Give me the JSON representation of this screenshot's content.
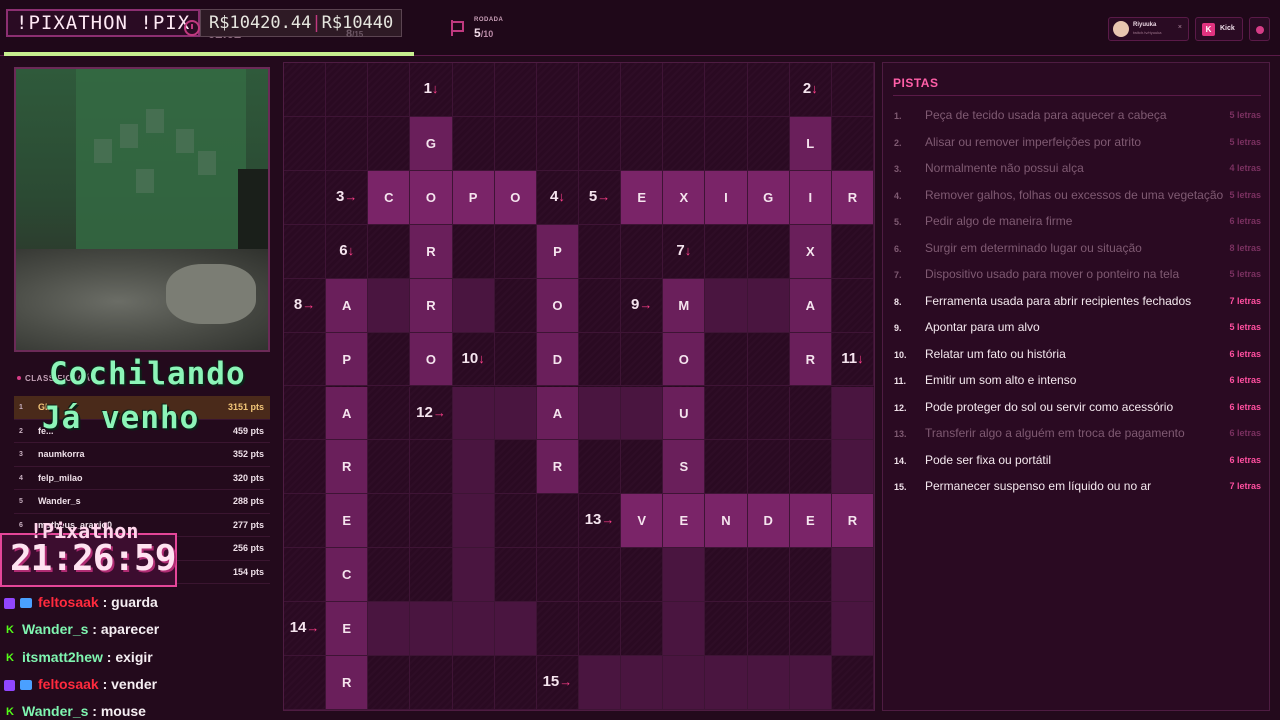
{
  "header": {
    "brand": "!PIXATHON !PIX",
    "timer": "02:02",
    "prize": "R$10420.44",
    "prize_sep": "|",
    "prize_goal": "R$10440",
    "progress": "8",
    "progress_total": "/15",
    "round_label": "RODADA",
    "round_value": "5",
    "round_total": "/10",
    "user_name": "Riyuuka",
    "user_sub": "twitch.tv/riyuuka",
    "user_close": "×",
    "kick_logo": "K",
    "kick_label": "Kick",
    "accent_color": "#d63c86",
    "progress_bar_fraction": 0.32
  },
  "overlay": {
    "status_line1": "Cochilando",
    "status_line2": "Já venho",
    "clock_label": "!Pixathon",
    "clock": "21:26:59"
  },
  "leaderboard": {
    "title": "CLASSIFICAÇÃO",
    "rows": [
      {
        "rank": "1",
        "name": "Gh...",
        "pts": "3151 pts"
      },
      {
        "rank": "2",
        "name": "fe...",
        "pts": "459 pts"
      },
      {
        "rank": "3",
        "name": "naumkorra",
        "pts": "352 pts"
      },
      {
        "rank": "4",
        "name": "felp_milao",
        "pts": "320 pts"
      },
      {
        "rank": "5",
        "name": "Wander_s",
        "pts": "288 pts"
      },
      {
        "rank": "6",
        "name": "matheus_araujo0",
        "pts": "277 pts"
      },
      {
        "rank": "7",
        "name": "",
        "pts": "256 pts"
      },
      {
        "rank": "8",
        "name": "",
        "pts": "154 pts"
      }
    ]
  },
  "chat": [
    {
      "badge": "twitch",
      "extra": true,
      "user": "feltosaak",
      "color": "#ff2a3d",
      "msg": " : guarda"
    },
    {
      "badge": "kick",
      "extra": false,
      "user": "Wander_s",
      "color": "#7ff5b0",
      "msg": " : aparecer"
    },
    {
      "badge": "kick",
      "extra": false,
      "user": "itsmatt2hew",
      "color": "#7ff5b0",
      "msg": " : exigir"
    },
    {
      "badge": "twitch",
      "extra": true,
      "user": "feltosaak",
      "color": "#ff2a3d",
      "msg": " : vender"
    },
    {
      "badge": "kick",
      "extra": false,
      "user": "Wander_s",
      "color": "#7ff5b0",
      "msg": " : mouse"
    }
  ],
  "grid": {
    "rows": 12,
    "cols": 14,
    "cells": [
      {
        "r": 0,
        "c": 3,
        "t": "num",
        "v": "1",
        "a": "↓"
      },
      {
        "r": 0,
        "c": 12,
        "t": "num",
        "v": "2",
        "a": "↓"
      },
      {
        "r": 1,
        "c": 3,
        "t": "letter",
        "v": "G"
      },
      {
        "r": 1,
        "c": 12,
        "t": "letter",
        "v": "L"
      },
      {
        "r": 2,
        "c": 1,
        "t": "num",
        "v": "3",
        "a": "→"
      },
      {
        "r": 2,
        "c": 2,
        "t": "hl",
        "v": "C"
      },
      {
        "r": 2,
        "c": 3,
        "t": "hl",
        "v": "O"
      },
      {
        "r": 2,
        "c": 4,
        "t": "hl",
        "v": "P"
      },
      {
        "r": 2,
        "c": 5,
        "t": "hl",
        "v": "O"
      },
      {
        "r": 2,
        "c": 6,
        "t": "num",
        "v": "4",
        "a": "↓"
      },
      {
        "r": 2,
        "c": 7,
        "t": "num",
        "v": "5",
        "a": "→"
      },
      {
        "r": 2,
        "c": 8,
        "t": "hl",
        "v": "E"
      },
      {
        "r": 2,
        "c": 9,
        "t": "hl",
        "v": "X"
      },
      {
        "r": 2,
        "c": 10,
        "t": "hl",
        "v": "I"
      },
      {
        "r": 2,
        "c": 11,
        "t": "hl",
        "v": "G"
      },
      {
        "r": 2,
        "c": 12,
        "t": "hl",
        "v": "I"
      },
      {
        "r": 2,
        "c": 13,
        "t": "hl",
        "v": "R"
      },
      {
        "r": 3,
        "c": 1,
        "t": "num",
        "v": "6",
        "a": "↓"
      },
      {
        "r": 3,
        "c": 3,
        "t": "letter",
        "v": "R"
      },
      {
        "r": 3,
        "c": 6,
        "t": "letter",
        "v": "P"
      },
      {
        "r": 3,
        "c": 9,
        "t": "num",
        "v": "7",
        "a": "↓"
      },
      {
        "r": 3,
        "c": 12,
        "t": "letter",
        "v": "X"
      },
      {
        "r": 4,
        "c": 0,
        "t": "num",
        "v": "8",
        "a": "→"
      },
      {
        "r": 4,
        "c": 1,
        "t": "letter",
        "v": "A"
      },
      {
        "r": 4,
        "c": 2,
        "t": "active",
        "v": ""
      },
      {
        "r": 4,
        "c": 3,
        "t": "letter",
        "v": "R"
      },
      {
        "r": 4,
        "c": 4,
        "t": "active",
        "v": ""
      },
      {
        "r": 4,
        "c": 6,
        "t": "letter",
        "v": "O"
      },
      {
        "r": 4,
        "c": 8,
        "t": "num",
        "v": "9",
        "a": "→"
      },
      {
        "r": 4,
        "c": 9,
        "t": "letter",
        "v": "M"
      },
      {
        "r": 4,
        "c": 10,
        "t": "active",
        "v": ""
      },
      {
        "r": 4,
        "c": 11,
        "t": "active",
        "v": ""
      },
      {
        "r": 4,
        "c": 12,
        "t": "letter",
        "v": "A"
      },
      {
        "r": 5,
        "c": 1,
        "t": "letter",
        "v": "P"
      },
      {
        "r": 5,
        "c": 3,
        "t": "letter",
        "v": "O"
      },
      {
        "r": 5,
        "c": 4,
        "t": "num",
        "v": "10",
        "a": "↓"
      },
      {
        "r": 5,
        "c": 6,
        "t": "letter",
        "v": "D"
      },
      {
        "r": 5,
        "c": 9,
        "t": "letter",
        "v": "O"
      },
      {
        "r": 5,
        "c": 12,
        "t": "letter",
        "v": "R"
      },
      {
        "r": 5,
        "c": 13,
        "t": "num",
        "v": "11",
        "a": "↓"
      },
      {
        "r": 6,
        "c": 1,
        "t": "letter",
        "v": "A"
      },
      {
        "r": 6,
        "c": 3,
        "t": "num",
        "v": "12",
        "a": "→"
      },
      {
        "r": 6,
        "c": 4,
        "t": "active",
        "v": ""
      },
      {
        "r": 6,
        "c": 5,
        "t": "active",
        "v": ""
      },
      {
        "r": 6,
        "c": 6,
        "t": "letter",
        "v": "A"
      },
      {
        "r": 6,
        "c": 7,
        "t": "active",
        "v": ""
      },
      {
        "r": 6,
        "c": 8,
        "t": "active",
        "v": ""
      },
      {
        "r": 6,
        "c": 9,
        "t": "letter",
        "v": "U"
      },
      {
        "r": 6,
        "c": 13,
        "t": "active",
        "v": ""
      },
      {
        "r": 7,
        "c": 1,
        "t": "letter",
        "v": "R"
      },
      {
        "r": 7,
        "c": 4,
        "t": "active",
        "v": ""
      },
      {
        "r": 7,
        "c": 6,
        "t": "letter",
        "v": "R"
      },
      {
        "r": 7,
        "c": 9,
        "t": "letter",
        "v": "S"
      },
      {
        "r": 7,
        "c": 13,
        "t": "active",
        "v": ""
      },
      {
        "r": 8,
        "c": 1,
        "t": "letter",
        "v": "E"
      },
      {
        "r": 8,
        "c": 4,
        "t": "active",
        "v": ""
      },
      {
        "r": 8,
        "c": 7,
        "t": "num",
        "v": "13",
        "a": "→"
      },
      {
        "r": 8,
        "c": 8,
        "t": "hl",
        "v": "V"
      },
      {
        "r": 8,
        "c": 9,
        "t": "hl",
        "v": "E"
      },
      {
        "r": 8,
        "c": 10,
        "t": "hl",
        "v": "N"
      },
      {
        "r": 8,
        "c": 11,
        "t": "hl",
        "v": "D"
      },
      {
        "r": 8,
        "c": 12,
        "t": "hl",
        "v": "E"
      },
      {
        "r": 8,
        "c": 13,
        "t": "hl",
        "v": "R"
      },
      {
        "r": 9,
        "c": 1,
        "t": "letter",
        "v": "C"
      },
      {
        "r": 9,
        "c": 4,
        "t": "active",
        "v": ""
      },
      {
        "r": 9,
        "c": 9,
        "t": "active",
        "v": ""
      },
      {
        "r": 9,
        "c": 13,
        "t": "active",
        "v": ""
      },
      {
        "r": 10,
        "c": 0,
        "t": "num",
        "v": "14",
        "a": "→"
      },
      {
        "r": 10,
        "c": 1,
        "t": "letter",
        "v": "E"
      },
      {
        "r": 10,
        "c": 2,
        "t": "active",
        "v": ""
      },
      {
        "r": 10,
        "c": 3,
        "t": "active",
        "v": ""
      },
      {
        "r": 10,
        "c": 4,
        "t": "active",
        "v": ""
      },
      {
        "r": 10,
        "c": 5,
        "t": "active",
        "v": ""
      },
      {
        "r": 10,
        "c": 9,
        "t": "active",
        "v": ""
      },
      {
        "r": 10,
        "c": 13,
        "t": "active",
        "v": ""
      },
      {
        "r": 11,
        "c": 1,
        "t": "letter",
        "v": "R"
      },
      {
        "r": 11,
        "c": 6,
        "t": "num",
        "v": "15",
        "a": "→"
      },
      {
        "r": 11,
        "c": 7,
        "t": "active",
        "v": ""
      },
      {
        "r": 11,
        "c": 8,
        "t": "active",
        "v": ""
      },
      {
        "r": 11,
        "c": 9,
        "t": "active",
        "v": ""
      },
      {
        "r": 11,
        "c": 10,
        "t": "active",
        "v": ""
      },
      {
        "r": 11,
        "c": 11,
        "t": "active",
        "v": ""
      },
      {
        "r": 11,
        "c": 12,
        "t": "active",
        "v": ""
      }
    ]
  },
  "clues": {
    "title": "PISTAS",
    "items": [
      {
        "num": "1.",
        "text": "Peça de tecido usada para aquecer a cabeça",
        "len": "5 letras",
        "done": true
      },
      {
        "num": "2.",
        "text": "Alisar ou remover imperfeições por atrito",
        "len": "5 letras",
        "done": true
      },
      {
        "num": "3.",
        "text": "Normalmente não possui alça",
        "len": "4 letras",
        "done": true
      },
      {
        "num": "4.",
        "text": "Remover galhos, folhas ou excessos de uma vegetação",
        "len": "5 letras",
        "done": true
      },
      {
        "num": "5.",
        "text": "Pedir algo de maneira firme",
        "len": "6 letras",
        "done": true
      },
      {
        "num": "6.",
        "text": "Surgir em determinado lugar ou situação",
        "len": "8 letras",
        "done": true
      },
      {
        "num": "7.",
        "text": "Dispositivo usado para mover o ponteiro na tela",
        "len": "5 letras",
        "done": true
      },
      {
        "num": "8.",
        "text": "Ferramenta usada para abrir recipientes fechados",
        "len": "7 letras",
        "done": false
      },
      {
        "num": "9.",
        "text": "Apontar para um alvo",
        "len": "5 letras",
        "done": false
      },
      {
        "num": "10.",
        "text": "Relatar um fato ou história",
        "len": "6 letras",
        "done": false
      },
      {
        "num": "11.",
        "text": "Emitir um som alto e intenso",
        "len": "6 letras",
        "done": false
      },
      {
        "num": "12.",
        "text": "Pode proteger do sol ou servir como acessório",
        "len": "6 letras",
        "done": false
      },
      {
        "num": "13.",
        "text": "Transferir algo a alguém em troca de pagamento",
        "len": "6 letras",
        "done": true
      },
      {
        "num": "14.",
        "text": "Pode ser fixa ou portátil",
        "len": "6 letras",
        "done": false
      },
      {
        "num": "15.",
        "text": "Permanecer suspenso em líquido ou no ar",
        "len": "7 letras",
        "done": false
      }
    ]
  }
}
